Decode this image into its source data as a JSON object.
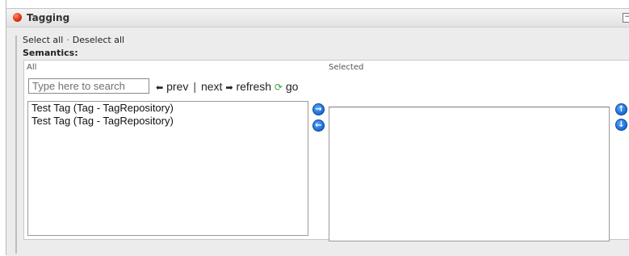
{
  "panel": {
    "title": "Tagging",
    "collapse_symbol": "−"
  },
  "selection": {
    "select_all": "Select all",
    "separator": "·",
    "deselect_all": "Deselect all"
  },
  "semantics_label": "Semantics:",
  "all_column": {
    "label": "All",
    "search_placeholder": "Type here to search",
    "prev_label": "prev",
    "divider": "|",
    "next_label": "next",
    "refresh_label": "refresh",
    "go_label": "go",
    "items": [
      "Test Tag (Tag - TagRepository)",
      "Test Tag (Tag - TagRepository)"
    ]
  },
  "selected_column": {
    "label": "Selected",
    "items": []
  },
  "icons": {
    "status": "red-dot-icon",
    "prev": "arrow-left-icon",
    "next": "arrow-right-icon",
    "refresh": "refresh-icon",
    "add": "arrow-right-circle-icon",
    "remove": "arrow-left-circle-icon",
    "move_up": "arrow-up-circle-icon",
    "move_down": "arrow-down-circle-icon"
  },
  "colors": {
    "status_dot": "#e02a10",
    "action_button": "#1c6fd8",
    "refresh_icon": "#3ba13b"
  }
}
